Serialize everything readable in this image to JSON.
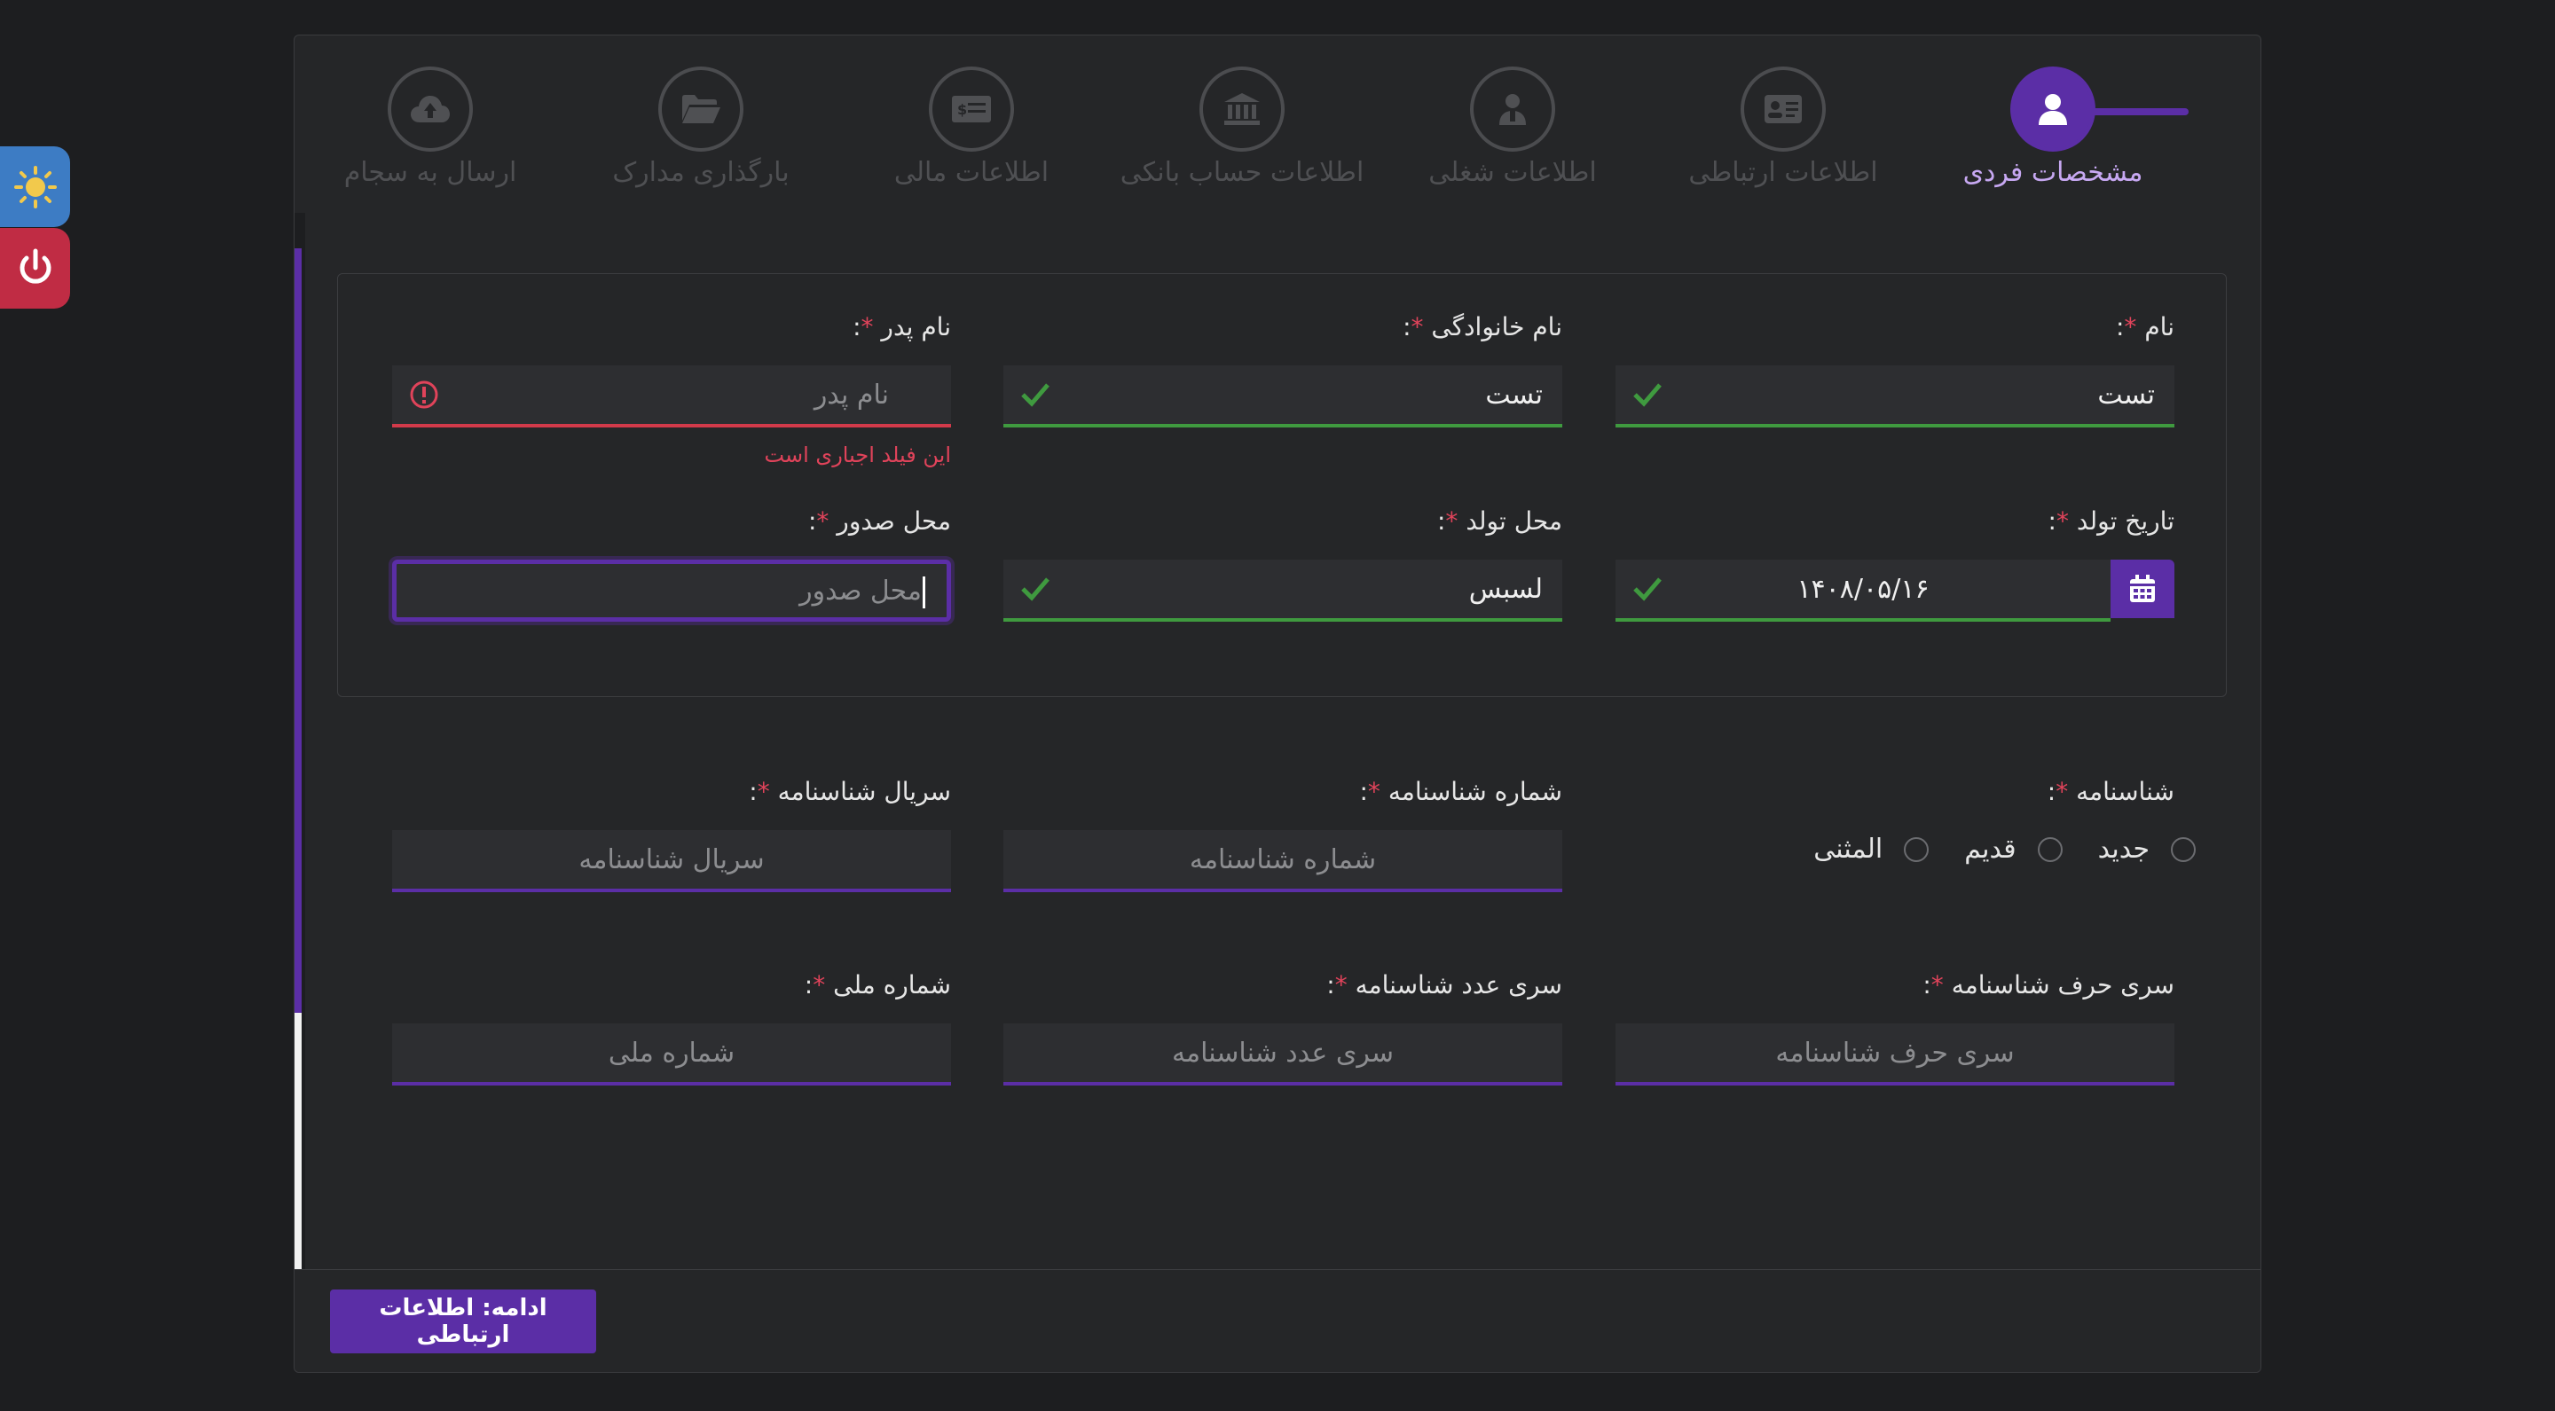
{
  "steps": [
    {
      "label": "مشخصات فردی",
      "icon": "user-icon",
      "active": true
    },
    {
      "label": "اطلاعات ارتباطی",
      "icon": "contact-card-icon"
    },
    {
      "label": "اطلاعات شغلی",
      "icon": "job-icon"
    },
    {
      "label": "اطلاعات حساب بانکی",
      "icon": "bank-icon"
    },
    {
      "label": "اطلاعات مالی",
      "icon": "money-icon"
    },
    {
      "label": "بارگذاری مدارک",
      "icon": "folder-icon"
    },
    {
      "label": "ارسال به سجام",
      "icon": "cloud-upload-icon"
    }
  ],
  "required_mark": "*",
  "label_suffix": ":",
  "form": {
    "first_name": {
      "label": "نام",
      "value": "تست"
    },
    "last_name": {
      "label": "نام خانوادگی",
      "value": "تست"
    },
    "father_name": {
      "label": "نام پدر",
      "placeholder": "نام پدر",
      "error": "این فیلد اجباری است"
    },
    "birth_date": {
      "label": "تاریخ تولد",
      "value": "۱۴۰۸/۰۵/۱۶"
    },
    "birth_place": {
      "label": "محل تولد",
      "value": "لسبس"
    },
    "issue_place": {
      "label": "محل صدور",
      "placeholder": "محل صدور"
    },
    "id_card": {
      "label": "شناسنامه",
      "options": [
        "جدید",
        "قدیم",
        "المثنی"
      ]
    },
    "id_number": {
      "label": "شماره شناسنامه",
      "placeholder": "شماره شناسنامه"
    },
    "id_serial": {
      "label": "سریال شناسنامه",
      "placeholder": "سریال شناسنامه"
    },
    "id_letter_series": {
      "label": "سری حرف شناسنامه",
      "placeholder": "سری حرف شناسنامه"
    },
    "id_number_series": {
      "label": "سری عدد شناسنامه",
      "placeholder": "سری عدد شناسنامه"
    },
    "national_code": {
      "label": "شماره ملی",
      "placeholder": "شماره ملی"
    }
  },
  "footer": {
    "next_label": "ادامه: اطلاعات ارتباطی"
  },
  "colors": {
    "accent": "#5b2ea6",
    "success": "#3f9a3f",
    "error": "#e0435a",
    "theme_button": "#3d7cc4",
    "power_button": "#c02c44"
  }
}
